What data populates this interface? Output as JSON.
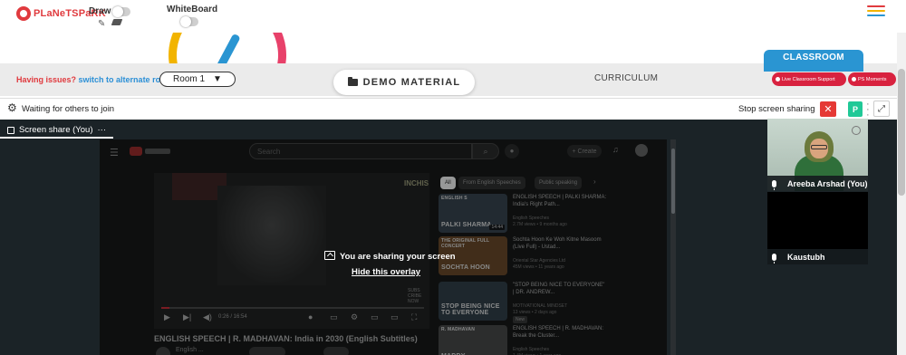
{
  "brand": {
    "logo_text_a": "PLaNeT",
    "logo_text_b": "SPaRK",
    "accent": "#e03a3e"
  },
  "toolbar": {
    "draw_label": "Draw",
    "whiteboard_label": "WhiteBoard",
    "draw_toggle_on": false,
    "whiteboard_toggle_on": false
  },
  "menu": {
    "hamburger_colors": [
      "#e03a3e",
      "#f2b400",
      "#2a95d2"
    ]
  },
  "banner": {
    "issues_question": "Having issues?",
    "issues_link": "switch to alternate room",
    "room_selected": "Room 1",
    "demo_material": "DEMO MATERIAL",
    "curriculum": "CURRICULUM",
    "classroom_tab": "CLASSROOM",
    "live_support": "Live Classroom Support",
    "ps_moments": "PS Moments"
  },
  "call": {
    "waiting_text": "Waiting for others to join",
    "stop_sharing": "Stop screen sharing",
    "p_button": "P",
    "share_tab": "Screen share (You)",
    "share_tab_more": "···"
  },
  "youtube": {
    "search_placeholder": "Search",
    "create": "Create",
    "chips": [
      "All",
      "From English Speeches",
      "Public speaking"
    ],
    "player_watermark": "INCHIS",
    "player_time": "0:26 / 16:54",
    "progress": 0.03,
    "subscribe_tag": "SUBS\nCRIBE\nNOW",
    "video_title": "ENGLISH SPEECH | R. MADHAVAN: India in 2030 (English Subtitles)",
    "channel": "English ...",
    "recommendations": [
      {
        "title": "ENGLISH SPEECH | PALKI SHARMA: India's Right Path...",
        "channel": "English Speeches",
        "meta": "2.7M views • 9 months ago",
        "duration": "14:44",
        "thumb_text": "PALKI SHARMA",
        "thumb_top": "ENGLISH S",
        "thumb_color": "#2a3540",
        "badge": ""
      },
      {
        "title": "Sochta Hoon Ke Woh Kitne Masoom (Live Full) - Ustad...",
        "channel": "Oriental Star Agencies Ltd",
        "meta": "45M views • 11 years ago",
        "duration": "",
        "thumb_text": "SOCHTA HOON",
        "thumb_top": "THE ORIGINAL FULL CONCERT",
        "thumb_color": "#5a3a1c",
        "badge": ""
      },
      {
        "title": "\"STOP BEING NICE TO EVERYONE\" | DR. ANDREW...",
        "channel": "MOTIVATIONAL MINDSET",
        "meta": "13 views • 2 days ago",
        "duration": "",
        "thumb_text": "STOP BEING NICE TO EVERYONE",
        "thumb_top": "",
        "thumb_color": "#24303a",
        "badge": "New"
      },
      {
        "title": "ENGLISH SPEECH | R. MADHAVAN: Break the Cluster...",
        "channel": "English Speeches",
        "meta": "1.4M views • 1 year ago",
        "duration": "",
        "thumb_text": "MADDY",
        "thumb_top": "R. MADHAVAN",
        "thumb_color": "#3a3a3a",
        "badge": ""
      }
    ]
  },
  "overlay": {
    "sharing_text": "You are sharing your screen",
    "hide_link": "Hide this overlay"
  },
  "participants": [
    {
      "name": "Areeba Arshad (You)"
    },
    {
      "name": "Kaustubh"
    }
  ]
}
